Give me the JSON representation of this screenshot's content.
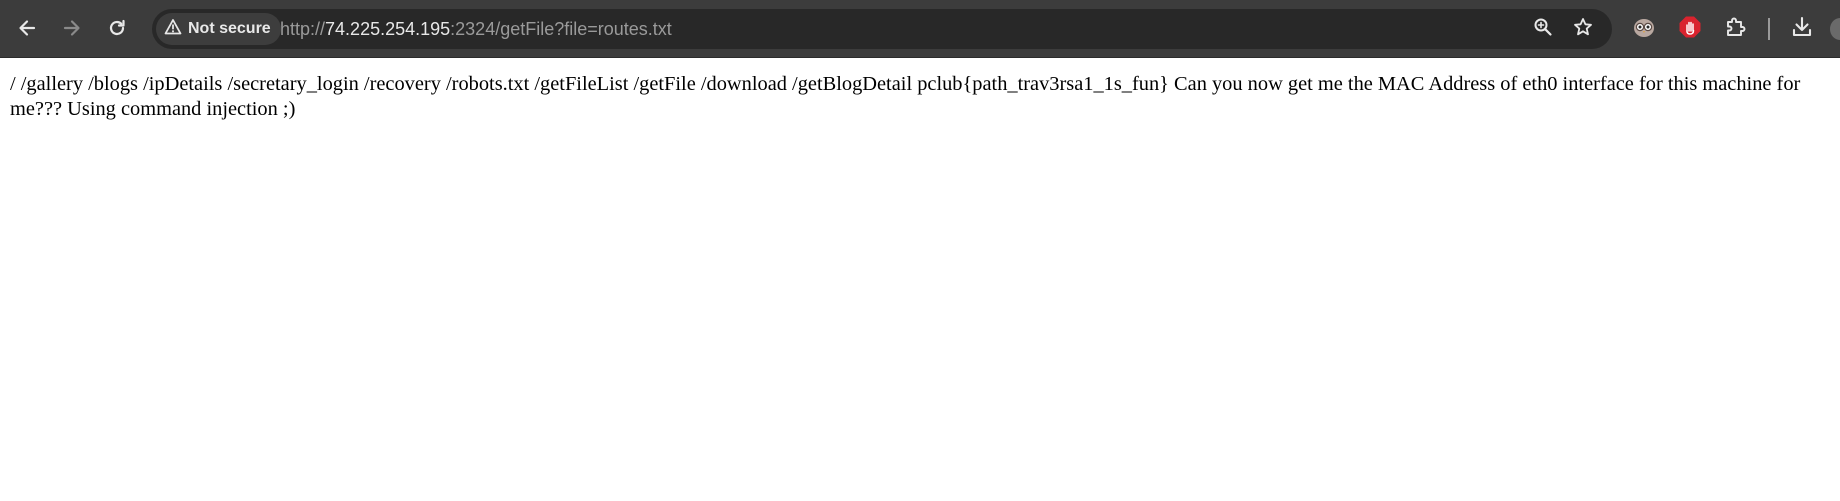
{
  "browser": {
    "security_label": "Not secure",
    "url": {
      "scheme": "http://",
      "host": "74.225.254.195",
      "rest": ":2324/getFile?file=routes.txt"
    },
    "icons": {
      "back": "back-arrow-icon",
      "forward": "forward-arrow-icon",
      "reload": "reload-icon",
      "warning": "warning-triangle-icon",
      "zoom": "zoom-icon",
      "bookmark": "star-icon",
      "ext_1": "owl-extension-icon",
      "ext_2": "stop-hand-extension-icon",
      "extensions": "puzzle-icon",
      "downloads": "download-icon"
    },
    "colors": {
      "toolbar": "#3c3c3c",
      "omnibox": "#282828",
      "ext_red": "#d9232e"
    }
  },
  "page": {
    "body_text": "/ /gallery /blogs /ipDetails /secretary_login /recovery /robots.txt /getFileList /getFile /download /getBlogDetail pclub{path_trav3rsa1_1s_fun} Can you now get me the MAC Address of eth0 interface for this machine for me??? Using command injection ;)"
  }
}
